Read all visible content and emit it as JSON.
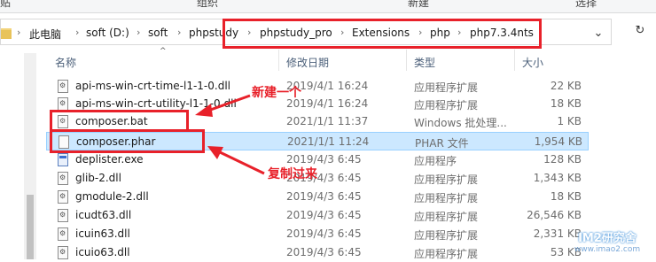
{
  "ribbon": {
    "labels": [
      "贴",
      "组织",
      "新建",
      "选择"
    ]
  },
  "address": {
    "crumbs": [
      "此电脑",
      "soft (D:)",
      "soft",
      "phpstudy",
      "phpstudy_pro",
      "Extensions",
      "php",
      "php7.3.4nts"
    ],
    "dropdown_icon": "chevron-down-icon",
    "refresh_icon": "refresh-icon"
  },
  "columns": {
    "name": "名称",
    "date": "修改日期",
    "type": "类型",
    "size": "大小"
  },
  "files": [
    {
      "name": "api-ms-win-crt-time-l1-1-0.dll",
      "date": "2019/4/1 16:24",
      "type": "应用程序扩展",
      "size": "22 KB",
      "icon": "dll"
    },
    {
      "name": "api-ms-win-crt-utility-l1-1-0.dll",
      "date": "2019/4/1 16:24",
      "type": "应用程序扩展",
      "size": "18 KB",
      "icon": "dll"
    },
    {
      "name": "composer.bat",
      "date": "2021/1/1 11:37",
      "type": "Windows 批处理...",
      "size": "1 KB",
      "icon": "bat"
    },
    {
      "name": "composer.phar",
      "date": "2021/1/1 11:24",
      "type": "PHAR 文件",
      "size": "1,954 KB",
      "icon": "phar"
    },
    {
      "name": "deplister.exe",
      "date": "2019/4/3 6:45",
      "type": "应用程序",
      "size": "128 KB",
      "icon": "exe"
    },
    {
      "name": "glib-2.dll",
      "date": "2019/4/3 6:45",
      "type": "应用程序扩展",
      "size": "1,343 KB",
      "icon": "dll"
    },
    {
      "name": "gmodule-2.dll",
      "date": "2019/4/3 6:45",
      "type": "应用程序扩展",
      "size": "18 KB",
      "icon": "dll"
    },
    {
      "name": "icudt63.dll",
      "date": "2019/4/3 6:45",
      "type": "应用程序扩展",
      "size": "26,546 KB",
      "icon": "dll"
    },
    {
      "name": "icuin63.dll",
      "date": "2019/4/3 6:45",
      "type": "应用程序扩展",
      "size": "2,331 KB",
      "icon": "dll"
    },
    {
      "name": "icuio63.dll",
      "date": "2019/4/3 6:45",
      "type": "应用程序扩展",
      "size": "53 KB",
      "icon": "dll"
    }
  ],
  "annotations": {
    "new_one": "新建一个",
    "copied": "复制过来"
  },
  "watermark": {
    "title": "IM2研究舍",
    "url": "www.imao2.com"
  },
  "colors": {
    "highlight": "#e8212a",
    "selection": "#cce8ff"
  }
}
